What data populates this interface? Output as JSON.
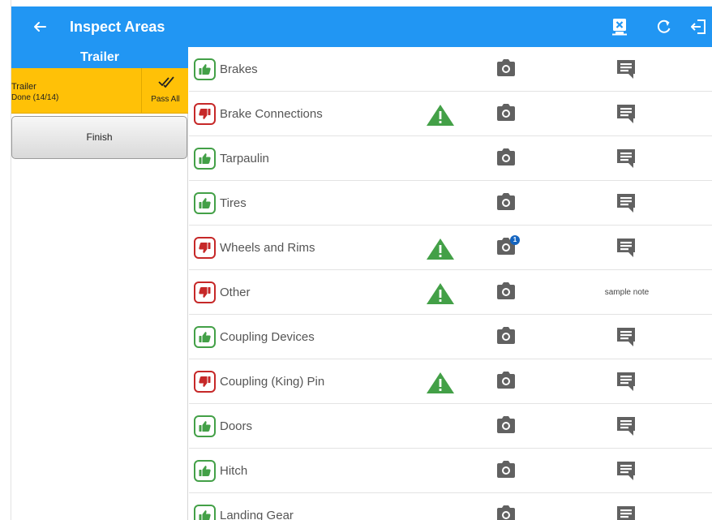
{
  "app_bar": {
    "title": "Inspect Areas",
    "back_icon": "arrow-left-icon",
    "actions": [
      "clear-icon",
      "refresh-icon",
      "logout-icon"
    ]
  },
  "sidebar": {
    "header": "Trailer",
    "areas": [
      {
        "name": "Trailer",
        "status": "Done (14/14)",
        "pass_all_label": "Pass All"
      }
    ],
    "finish_label": "Finish"
  },
  "items": [
    {
      "name": "Brakes",
      "status": "pass",
      "defect": false,
      "photo_count": 0,
      "note": ""
    },
    {
      "name": "Brake Connections",
      "status": "fail",
      "defect": true,
      "photo_count": 0,
      "note": ""
    },
    {
      "name": "Tarpaulin",
      "status": "pass",
      "defect": false,
      "photo_count": 0,
      "note": ""
    },
    {
      "name": "Tires",
      "status": "pass",
      "defect": false,
      "photo_count": 0,
      "note": ""
    },
    {
      "name": "Wheels and Rims",
      "status": "fail",
      "defect": true,
      "photo_count": 1,
      "note": ""
    },
    {
      "name": "Other",
      "status": "fail",
      "defect": true,
      "photo_count": 0,
      "note": "sample note"
    },
    {
      "name": "Coupling Devices",
      "status": "pass",
      "defect": false,
      "photo_count": 0,
      "note": ""
    },
    {
      "name": "Coupling (King) Pin",
      "status": "fail",
      "defect": true,
      "photo_count": 0,
      "note": ""
    },
    {
      "name": "Doors",
      "status": "pass",
      "defect": false,
      "photo_count": 0,
      "note": ""
    },
    {
      "name": "Hitch",
      "status": "pass",
      "defect": false,
      "photo_count": 0,
      "note": ""
    },
    {
      "name": "Landing Gear",
      "status": "pass",
      "defect": false,
      "photo_count": 0,
      "note": ""
    }
  ],
  "colors": {
    "primary": "#2196f3",
    "area_selected": "#ffc107",
    "pass": "#43a047",
    "fail": "#c62828",
    "defect_warning": "#43a047",
    "icon_gray": "#616161",
    "badge": "#1565c0"
  }
}
